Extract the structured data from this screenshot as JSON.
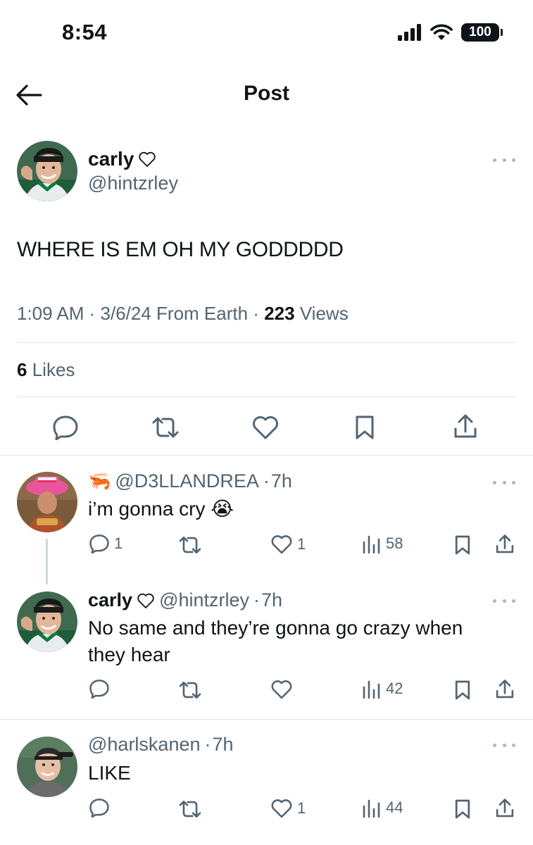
{
  "status": {
    "time": "8:54",
    "battery": "100"
  },
  "nav": {
    "title": "Post"
  },
  "post": {
    "author_name": "carly",
    "author_handle": "@hintzrley",
    "text": "WHERE IS EM OH MY GODDDDD",
    "time": "1:09 AM",
    "date": "3/6/24",
    "source": "From Earth",
    "views_count": "223",
    "views_label": "Views",
    "likes_count": "6",
    "likes_label": "Likes"
  },
  "replies": [
    {
      "handle": "@D3LLANDREA",
      "age": "7h",
      "text": "i’m gonna cry",
      "emoji": "😭",
      "reply_count": "1",
      "like_count": "1",
      "views": "58"
    },
    {
      "name": "carly",
      "handle": "@hintzrley",
      "age": "7h",
      "text": "No same and they’re gonna go crazy when they hear",
      "views": "42"
    },
    {
      "handle": "@harlskanen",
      "age": "7h",
      "text": "LIKE",
      "like_count": "1",
      "views": "44"
    }
  ],
  "icons": {
    "back": "arrow-left-icon",
    "more": "more-icon",
    "heart": "heart-outline-icon",
    "reply": "reply-icon",
    "retweet": "retweet-icon",
    "like": "like-icon",
    "bookmark": "bookmark-icon",
    "share": "share-icon",
    "views": "views-icon"
  },
  "colors": {
    "text": "#0f1419",
    "secondary": "#536471",
    "divider": "#e1e6ea"
  }
}
